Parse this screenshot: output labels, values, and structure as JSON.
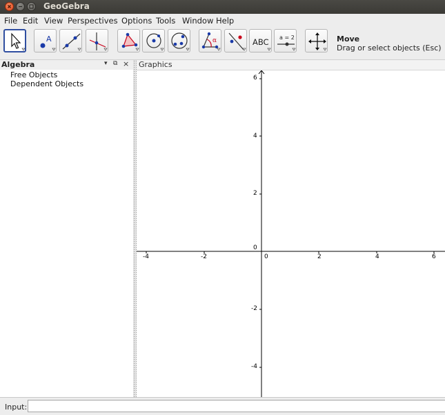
{
  "window": {
    "title": "GeoGebra"
  },
  "menubar": {
    "items": [
      "File",
      "Edit",
      "View",
      "Perspectives",
      "Options",
      "Tools",
      "Window",
      "Help"
    ]
  },
  "toolbar": {
    "tools": [
      {
        "name": "move-tool",
        "icon": "arrow-cursor-icon",
        "active": true
      },
      {
        "name": "point-tool",
        "icon": "point-A-icon"
      },
      {
        "name": "line-tool",
        "icon": "line-through-points-icon"
      },
      {
        "name": "perpendicular-line-tool",
        "icon": "perpendicular-line-icon"
      },
      {
        "name": "polygon-tool",
        "icon": "polygon-icon"
      },
      {
        "name": "circle-center-point-tool",
        "icon": "circle-center-icon"
      },
      {
        "name": "circle-three-points-tool",
        "icon": "circle-three-points-icon"
      },
      {
        "name": "angle-tool",
        "icon": "angle-icon",
        "label": "α"
      },
      {
        "name": "reflect-tool",
        "icon": "reflect-about-line-icon"
      },
      {
        "name": "text-tool",
        "icon": "text-abc-icon",
        "label": "ABC"
      },
      {
        "name": "slider-tool",
        "icon": "slider-icon",
        "label": "a = 2"
      },
      {
        "name": "move-graphics-tool",
        "icon": "move-graphics-view-icon"
      }
    ],
    "selected_title": "Move",
    "selected_description": "Drag or select objects (Esc)"
  },
  "algebra": {
    "title": "Algebra",
    "controls": {
      "menu": "▾",
      "undock": "⧉",
      "close": "×"
    },
    "items": [
      "Free Objects",
      "Dependent Objects"
    ]
  },
  "graphics": {
    "title": "Graphics",
    "x_ticks": [
      "-4",
      "-2",
      "0",
      "2",
      "4",
      "6"
    ],
    "y_ticks": [
      "6",
      "4",
      "2",
      "-2",
      "-4"
    ]
  },
  "input": {
    "label": "Input:",
    "value": ""
  },
  "colors": {
    "accent": "#2f4ea0",
    "point": "#1a3aa8",
    "angle": "#c8001a"
  }
}
